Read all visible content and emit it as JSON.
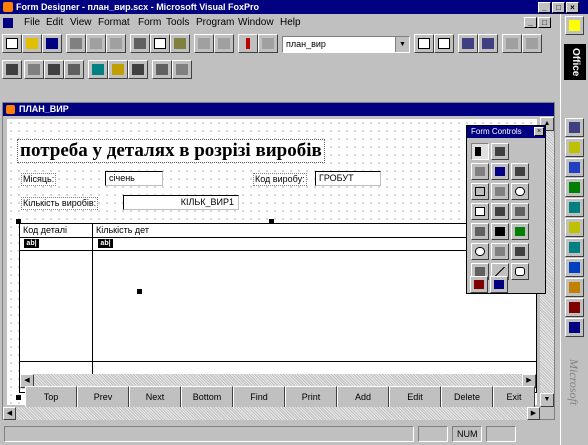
{
  "window": {
    "title": "Form Designer - план_вир.scx - Microsoft Visual FoxPro"
  },
  "menu": [
    "File",
    "Edit",
    "View",
    "Format",
    "Form",
    "Tools",
    "Program",
    "Window",
    "Help"
  ],
  "toolbar": {
    "combo_value": "план_вир"
  },
  "office_bar": {
    "label": "Office",
    "vendor": "Microsoft"
  },
  "form": {
    "title": "ПЛАН_ВИР",
    "heading": "потреба у деталях в розрізі виробів",
    "month_label": "Місяць:",
    "month_value": "січень",
    "product_code_label": "Код виробу:",
    "product_code_value": "ГРОБУТ",
    "quantity_label": "Кількість виробів:",
    "quantity_value": "КІЛЬК_ВИР1",
    "grid": {
      "columns": [
        "Код деталі",
        "Кількість дет"
      ],
      "cell_controls": [
        "ab|",
        "ab|"
      ]
    },
    "buttons": [
      "Top",
      "Prev",
      "Next",
      "Bottom",
      "Find",
      "Print",
      "Add",
      "Edit",
      "Delete",
      "Exit"
    ]
  },
  "toolbox": {
    "title": "Form Controls"
  },
  "status": {
    "num": "NUM"
  }
}
